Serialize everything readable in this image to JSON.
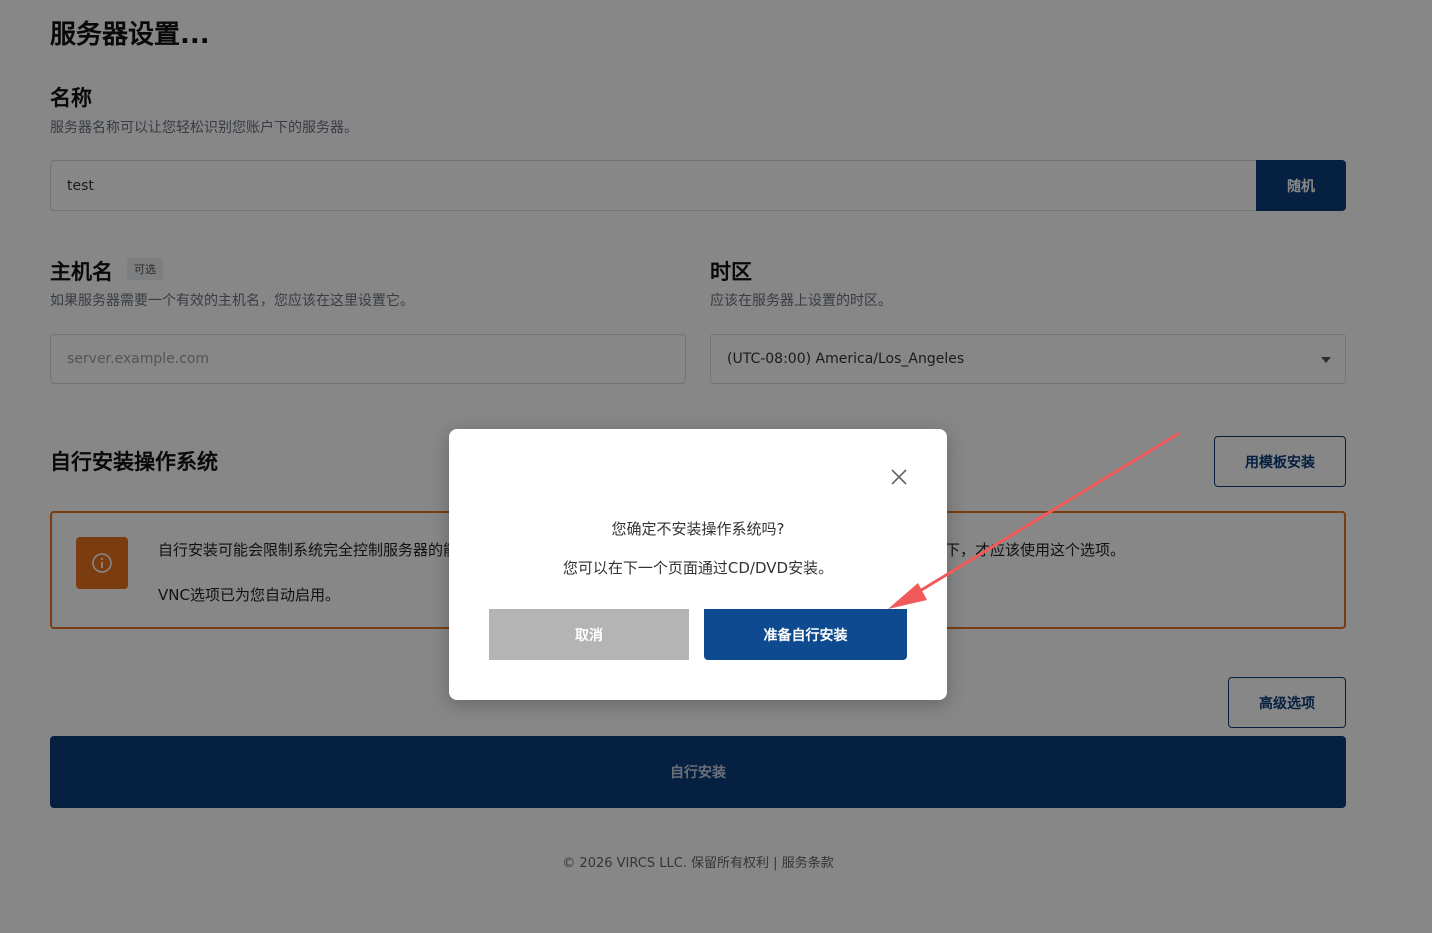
{
  "page_title": "服务器设置...",
  "name_section": {
    "title": "名称",
    "description": "服务器名称可以让您轻松识别您账户下的服务器。",
    "value": "test",
    "random_button": "随机"
  },
  "hostname_section": {
    "title": "主机名",
    "optional_badge": "可选",
    "description": "如果服务器需要一个有效的主机名，您应该在这里设置它。",
    "placeholder": "server.example.com"
  },
  "timezone_section": {
    "title": "时区",
    "description": "应该在服务器上设置的时区。",
    "selected": "(UTC-08:00) America/Los_Angeles"
  },
  "install_section": {
    "title": "自行安装操作系统",
    "template_button": "用模板安装",
    "warning_line1_left": "自行安装可能会限制系统完全控制服务器的能",
    "warning_line1_right": "下，才应该使用这个选项。",
    "warning_line2": "VNC选项已为您自动启用。",
    "advanced_button": "高级选项",
    "self_install_button": "自行安装"
  },
  "footer": "© 2026 VIRCS LLC. 保留所有权利 | 服务条款",
  "modal": {
    "question": "您确定不安装操作系统吗?",
    "subtext": "您可以在下一个页面通过CD/DVD安装。",
    "cancel_label": "取消",
    "confirm_label": "准备自行安装"
  },
  "colors": {
    "primary": "#0b3d7a",
    "warning": "#e8731f",
    "annotation_arrow": "#f05a5a"
  }
}
